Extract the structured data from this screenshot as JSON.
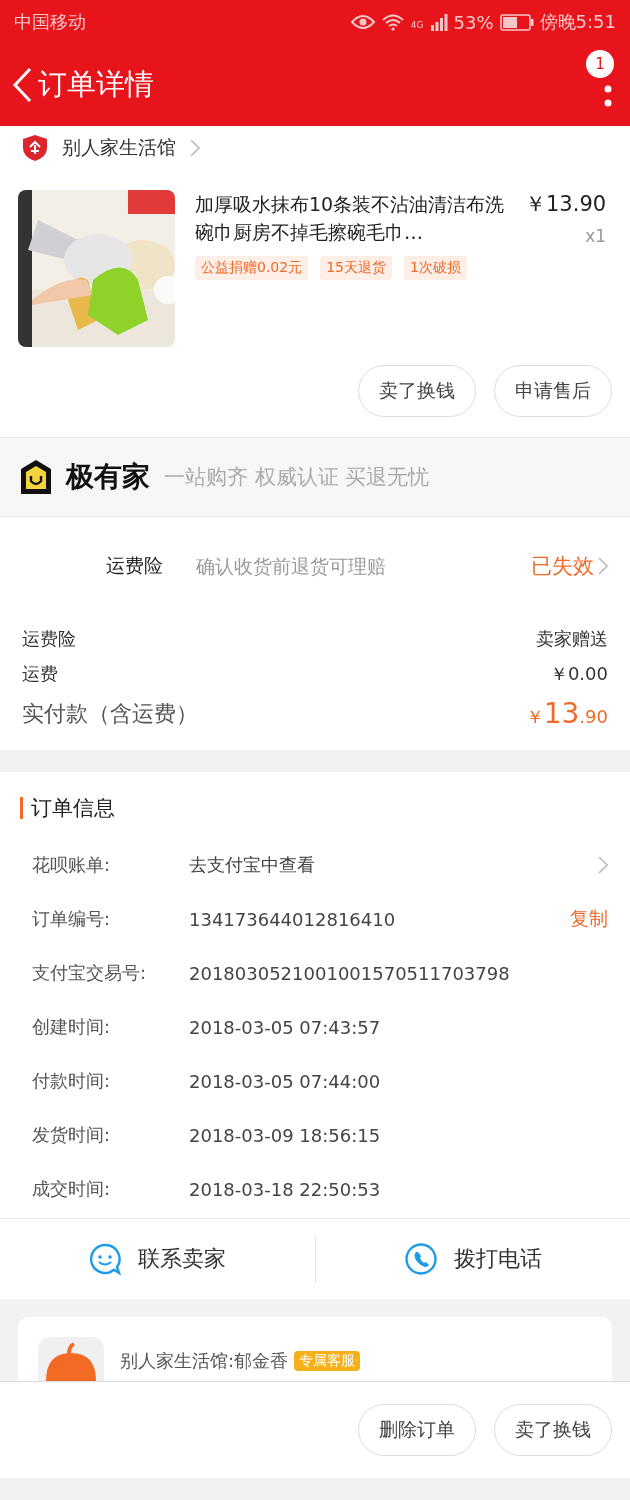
{
  "status_bar": {
    "carrier": "中国移动",
    "network": "4G",
    "battery": "53%",
    "time": "傍晚5:51"
  },
  "header": {
    "title": "订单详情",
    "badge": "1"
  },
  "store": {
    "name": "别人家生活馆"
  },
  "product": {
    "title": "加厚吸水抹布10条装不沾油清洁布洗碗巾厨房不掉毛擦碗毛巾…",
    "price": "￥13.90",
    "quantity": "x1",
    "tags": [
      "公益捐赠0.02元",
      "15天退货",
      "1次破损"
    ],
    "buttons": [
      "卖了换钱",
      "申请售后"
    ]
  },
  "banner": {
    "brand": "极有家",
    "slogan": "一站购齐 权威认证 买退无忧"
  },
  "insurance": {
    "label": "运费险",
    "description": "确认收货前退货可理赔",
    "status": "已失效"
  },
  "fees": [
    {
      "kind": "normal",
      "label": "运费险",
      "value": "卖家赠送"
    },
    {
      "kind": "normal",
      "label": "运费",
      "value": "￥0.00"
    },
    {
      "kind": "total",
      "label": "实付款（含运费）",
      "value": "￥13.90"
    }
  ],
  "order_info": {
    "title": "订单信息",
    "rows": [
      {
        "label": "花呗账单:",
        "value": "去支付宝中查看",
        "kind": "link"
      },
      {
        "label": "订单编号:",
        "value": "134173644012816410",
        "kind": "copy",
        "action": "复制"
      },
      {
        "label": "支付宝交易号:",
        "value": "2018030521001001570511703798",
        "kind": "plain"
      },
      {
        "label": "创建时间:",
        "value": "2018-03-05 07:43:57",
        "kind": "plain"
      },
      {
        "label": "付款时间:",
        "value": "2018-03-05 07:44:00",
        "kind": "plain"
      },
      {
        "label": "发货时间:",
        "value": "2018-03-09 18:56:15",
        "kind": "plain"
      },
      {
        "label": "成交时间:",
        "value": "2018-03-18 22:50:53",
        "kind": "plain"
      }
    ]
  },
  "contacts": [
    {
      "kind": "chat",
      "label": "联系卖家"
    },
    {
      "kind": "phone",
      "label": "拨打电话"
    }
  ],
  "service": {
    "name": "别人家生活馆:郁金香",
    "badge": "专属客服"
  },
  "bottom_buttons": [
    "删除订单",
    "卖了换钱"
  ]
}
